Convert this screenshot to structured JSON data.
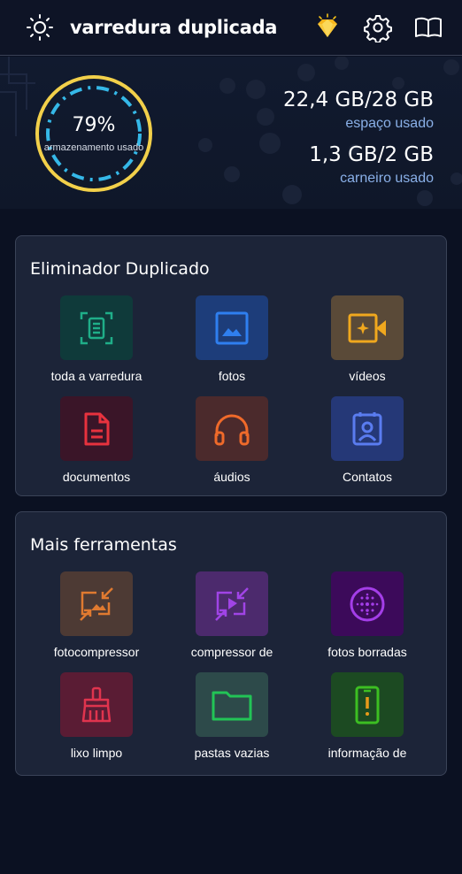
{
  "header": {
    "title": "varredura duplicada",
    "icons": [
      "brightness-icon",
      "premium-gem-icon",
      "settings-gear-icon",
      "guide-book-icon"
    ]
  },
  "storage": {
    "percent_label": "79%",
    "percent_value": 0.79,
    "gauge_label": "armazenamento usado",
    "storage_used": "22,4 GB/28 GB",
    "storage_used_label": "espaço usado",
    "ram_used": "1,3 GB/2 GB",
    "ram_used_label": "carneiro usado"
  },
  "duplicate_card": {
    "title": "Eliminador Duplicado",
    "items": [
      {
        "label": "toda a varredura",
        "icon": "scan-document-icon"
      },
      {
        "label": "fotos",
        "icon": "image-icon"
      },
      {
        "label": "vídeos",
        "icon": "video-camera-icon"
      },
      {
        "label": "documentos",
        "icon": "document-icon"
      },
      {
        "label": "áudios",
        "icon": "headphones-icon"
      },
      {
        "label": "Contatos",
        "icon": "contact-badge-icon"
      }
    ]
  },
  "tools_card": {
    "title": "Mais ferramentas",
    "items": [
      {
        "label": "fotocompressor",
        "icon": "photo-compress-icon"
      },
      {
        "label": "compressor de",
        "icon": "video-compress-icon"
      },
      {
        "label": "fotos borradas",
        "icon": "blur-icon"
      },
      {
        "label": "lixo limpo",
        "icon": "broom-icon"
      },
      {
        "label": "pastas vazias",
        "icon": "folder-icon"
      },
      {
        "label": "informação de",
        "icon": "phone-info-icon"
      }
    ]
  },
  "colors": {
    "background": "#0b1122",
    "card": "#1c2438",
    "gauge_ring": "#f2d04a",
    "gauge_dash": "#35b8e8",
    "stat_label": "#8ab0e8"
  }
}
